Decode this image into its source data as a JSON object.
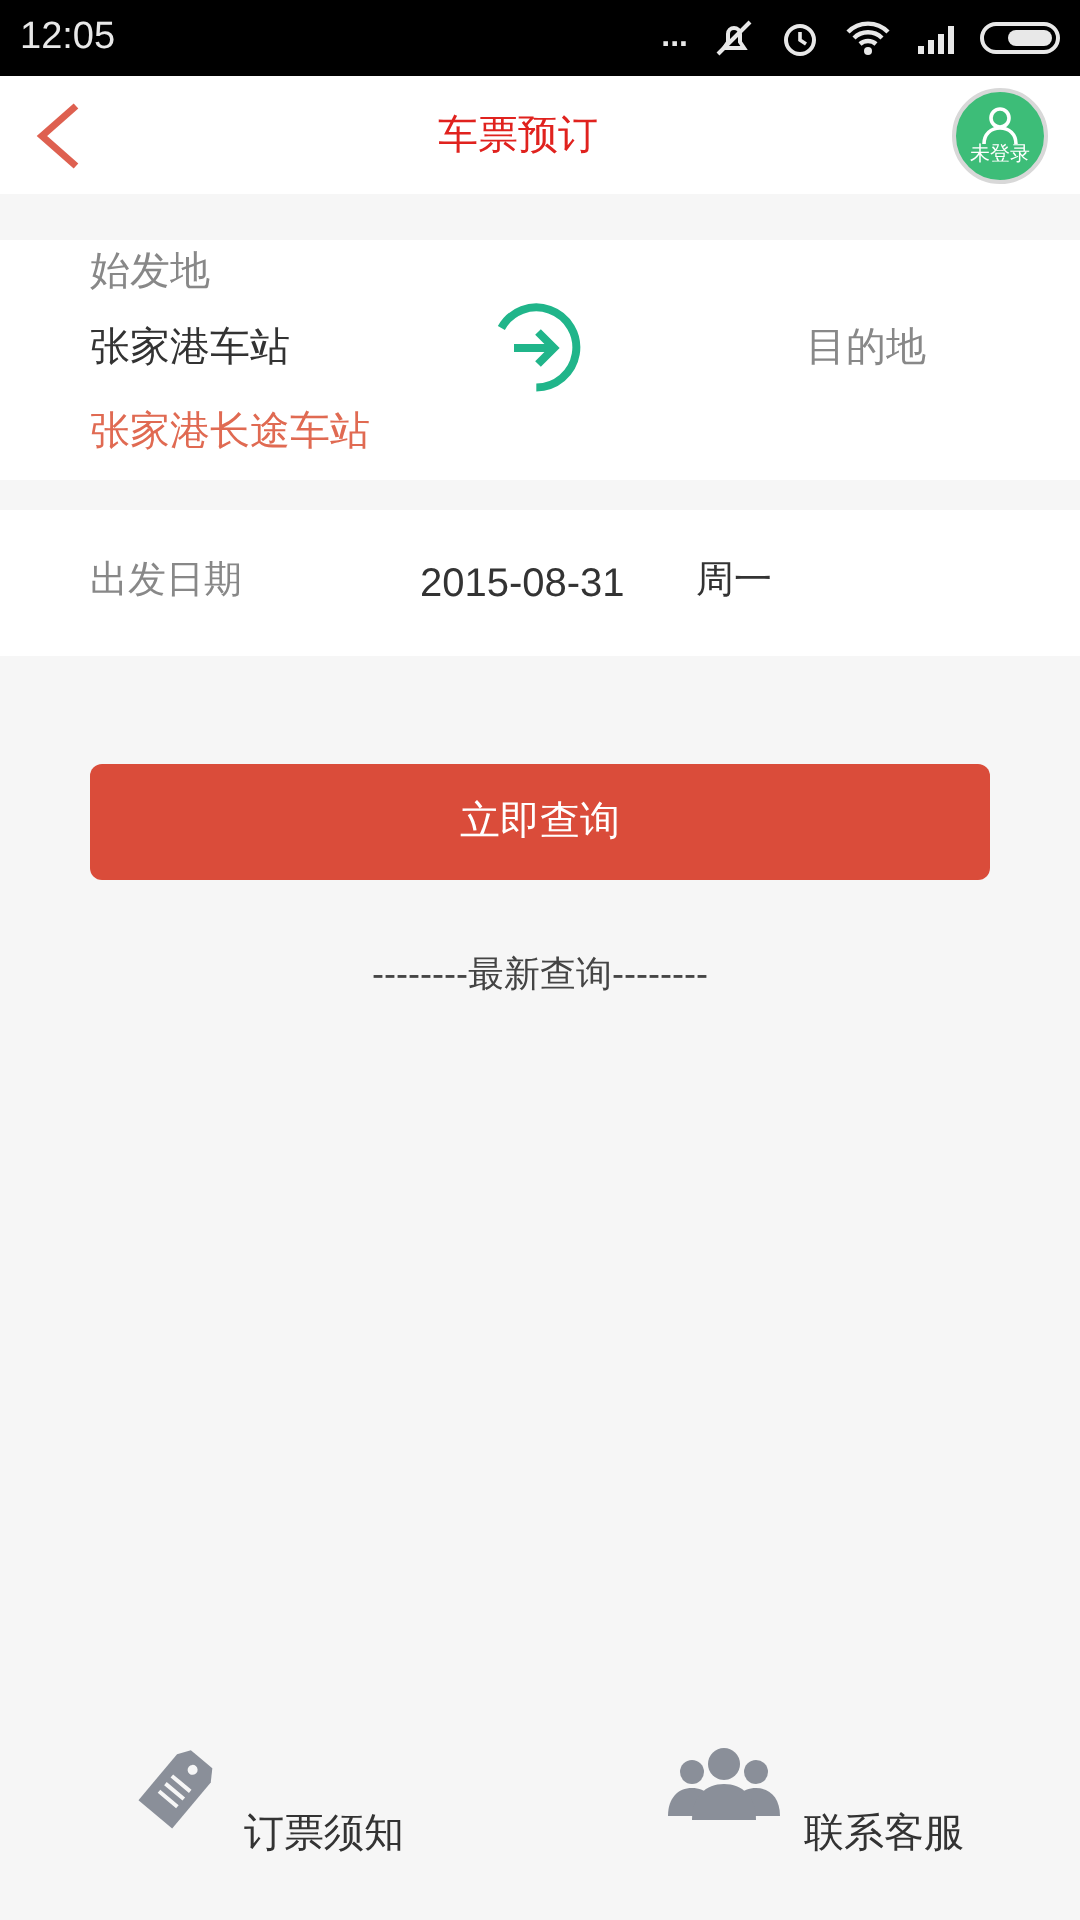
{
  "status_bar": {
    "time": "12:05",
    "dots": "..."
  },
  "header": {
    "title": "车票预订",
    "avatar_label": "未登录"
  },
  "route": {
    "origin_label": "始发地",
    "origin": "张家港车站",
    "destination": "目的地",
    "station": "张家港长途车站"
  },
  "date": {
    "label": "出发日期",
    "value": "2015-08-31",
    "weekday": "周一"
  },
  "search_button": "立即查询",
  "recent": "--------最新查询--------",
  "footer": [
    {
      "kind": "tag",
      "label": "订票须知"
    },
    {
      "kind": "people",
      "label": "联系客服"
    }
  ]
}
